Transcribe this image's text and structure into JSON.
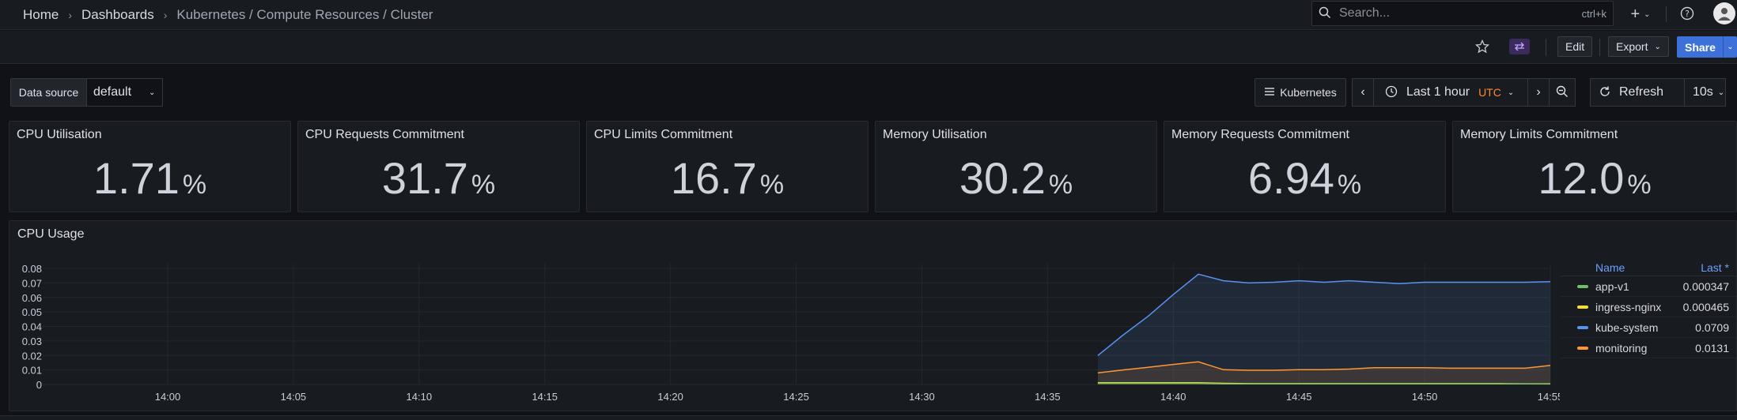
{
  "breadcrumb": {
    "items": [
      "Home",
      "Dashboards"
    ],
    "current": "Kubernetes / Compute Resources / Cluster"
  },
  "search": {
    "placeholder": "Search...",
    "shortcut": "ctrl+k"
  },
  "toolbar": {
    "edit_label": "Edit",
    "export_label": "Export",
    "share_label": "Share"
  },
  "controls": {
    "datasource_label": "Data source",
    "datasource_value": "default",
    "dashboard_link": "Kubernetes",
    "time_range": "Last 1 hour",
    "timezone": "UTC",
    "refresh_label": "Refresh",
    "refresh_interval": "10s"
  },
  "stats": [
    {
      "title": "CPU Utilisation",
      "value": "1.71",
      "unit": "%"
    },
    {
      "title": "CPU Requests Commitment",
      "value": "31.7",
      "unit": "%"
    },
    {
      "title": "CPU Limits Commitment",
      "value": "16.7",
      "unit": "%"
    },
    {
      "title": "Memory Utilisation",
      "value": "30.2",
      "unit": "%"
    },
    {
      "title": "Memory Requests Commitment",
      "value": "6.94",
      "unit": "%"
    },
    {
      "title": "Memory Limits Commitment",
      "value": "12.0",
      "unit": "%"
    }
  ],
  "cpu_panel": {
    "title": "CPU Usage",
    "legend": {
      "name_header": "Name",
      "last_header": "Last *"
    }
  },
  "colors": {
    "accent": "#3d71d9",
    "timezone": "#ff8833",
    "app-v1": "#73bf69",
    "ingress-nginx": "#fade2a",
    "kube-system": "#5794f2",
    "monitoring": "#ff9830"
  },
  "chart_data": {
    "type": "area",
    "title": "CPU Usage",
    "xlabel": "",
    "ylabel": "",
    "x_ticks": [
      "14:00",
      "14:05",
      "14:10",
      "14:15",
      "14:20",
      "14:25",
      "14:30",
      "14:35",
      "14:40",
      "14:45",
      "14:50",
      "14:55"
    ],
    "y_ticks": [
      "0",
      "0.01",
      "0.02",
      "0.03",
      "0.04",
      "0.05",
      "0.06",
      "0.07",
      "0.08"
    ],
    "ylim": [
      0,
      0.085
    ],
    "x": [
      "14:37",
      "14:38",
      "14:39",
      "14:40",
      "14:41",
      "14:42",
      "14:43",
      "14:44",
      "14:45",
      "14:46",
      "14:47",
      "14:48",
      "14:49",
      "14:50",
      "14:51",
      "14:52",
      "14:53",
      "14:54",
      "14:55"
    ],
    "series": [
      {
        "name": "app-v1",
        "values": [
          0.0008,
          0.0008,
          0.0008,
          0.0008,
          0.0008,
          0.0004,
          0.0004,
          0.0004,
          0.0004,
          0.0004,
          0.0004,
          0.0004,
          0.0004,
          0.0004,
          0.0004,
          0.0004,
          0.0004,
          0.0004,
          0.000347
        ]
      },
      {
        "name": "ingress-nginx",
        "values": [
          0.0012,
          0.0012,
          0.0012,
          0.0012,
          0.0012,
          0.0008,
          0.0006,
          0.0006,
          0.0006,
          0.0006,
          0.0006,
          0.0006,
          0.0006,
          0.0006,
          0.0006,
          0.0006,
          0.0006,
          0.0005,
          0.000465
        ]
      },
      {
        "name": "kube-system",
        "values": [
          0.02,
          0.034,
          0.047,
          0.062,
          0.076,
          0.0715,
          0.07,
          0.0705,
          0.0715,
          0.0705,
          0.0715,
          0.0705,
          0.0695,
          0.0705,
          0.0705,
          0.0705,
          0.0705,
          0.0705,
          0.0709
        ]
      },
      {
        "name": "monitoring",
        "values": [
          0.008,
          0.01,
          0.0118,
          0.0138,
          0.0156,
          0.0102,
          0.0098,
          0.0098,
          0.0102,
          0.0102,
          0.0106,
          0.0116,
          0.0116,
          0.0116,
          0.0112,
          0.0112,
          0.0112,
          0.0112,
          0.0131
        ]
      }
    ],
    "legend_last": [
      "0.000347",
      "0.000465",
      "0.0709",
      "0.0131"
    ],
    "legend_placement": "right",
    "grid": true
  }
}
